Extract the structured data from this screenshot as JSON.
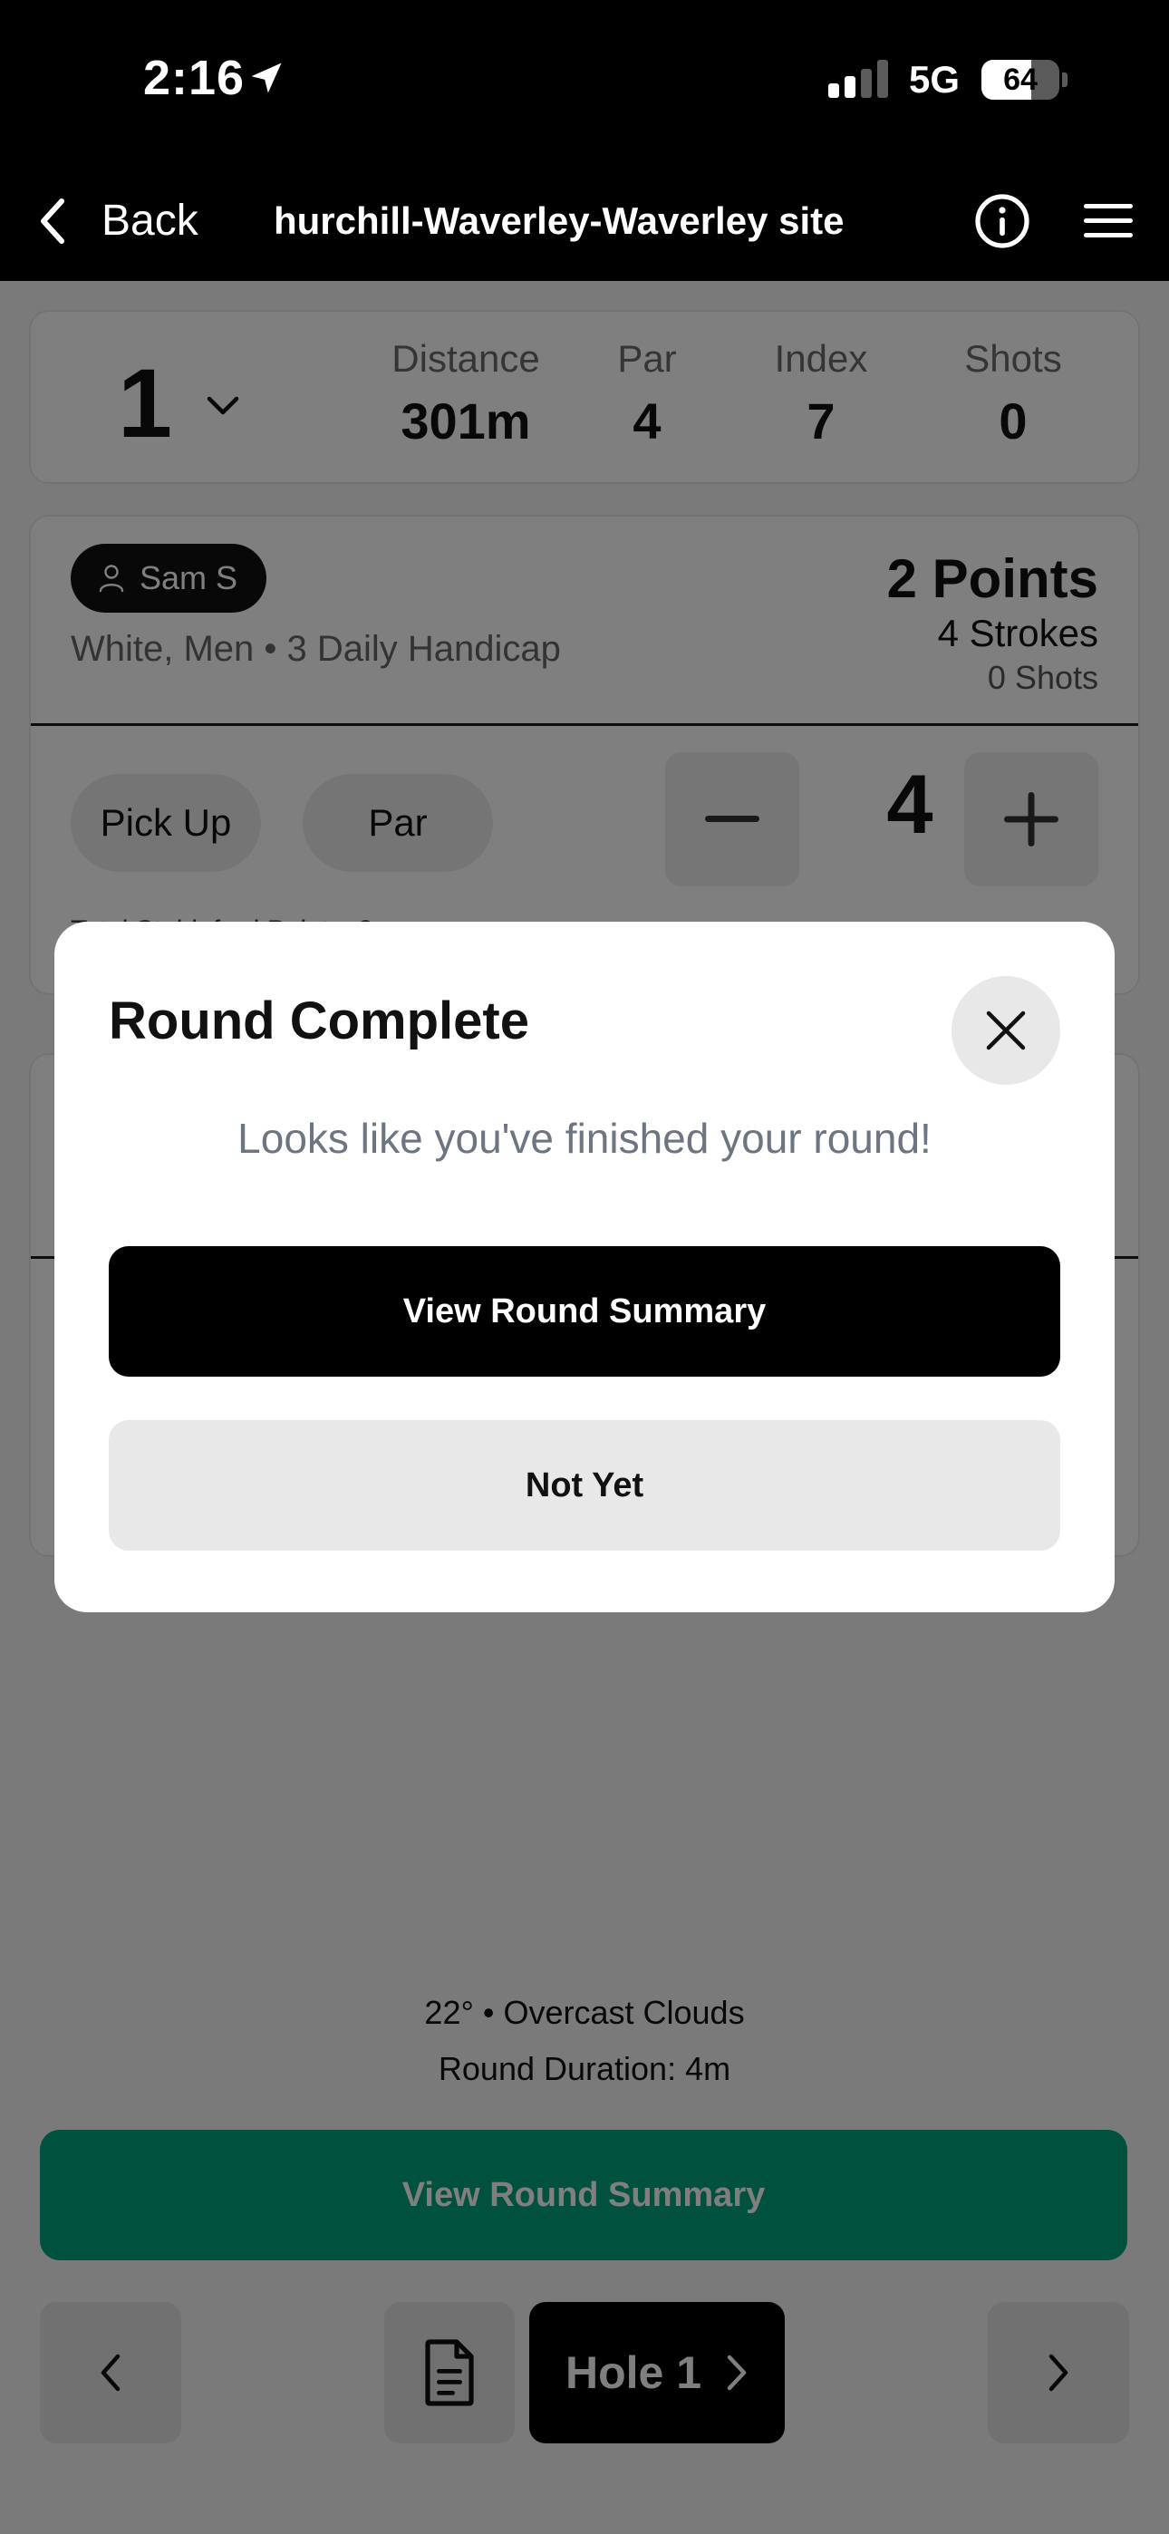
{
  "status_bar": {
    "time": "2:16",
    "network": "5G",
    "battery": "64",
    "battery_level": 0.64,
    "location_icon": "location-arrow-icon",
    "signal_icon": "signal-bars-icon"
  },
  "nav": {
    "back_label": "Back",
    "title": "hurchill-Waverley-Waverley site",
    "back_icon": "chevron-left-icon",
    "info_icon": "info-icon",
    "menu_icon": "hamburger-menu-icon"
  },
  "hole_info": {
    "hole_number": "1",
    "stats": [
      {
        "label": "Distance",
        "value": "301m"
      },
      {
        "label": "Par",
        "value": "4"
      },
      {
        "label": "Index",
        "value": "7"
      },
      {
        "label": "Shots",
        "value": "0"
      }
    ]
  },
  "player": {
    "name": "Sam S",
    "meta": "White, Men  • 3 Daily Handicap",
    "points": "2 Points",
    "strokes": "4 Strokes",
    "shots": "0 Shots",
    "pick_up_label": "Pick Up",
    "par_label": "Par",
    "score": "4",
    "stableford": "Total Stableford Points: 2"
  },
  "footer": {
    "weather": "22° • Overcast Clouds",
    "duration": "Round Duration: 4m",
    "summary_button": "View Round Summary",
    "hole_button": "Hole 1"
  },
  "modal": {
    "title": "Round Complete",
    "message": "Looks like you've finished your round!",
    "primary_button": "View Round Summary",
    "secondary_button": "Not Yet"
  },
  "colors": {
    "accent_green": "#00a27a",
    "primary": "#000000",
    "overlay": "rgba(0,0,0,0.5)"
  }
}
